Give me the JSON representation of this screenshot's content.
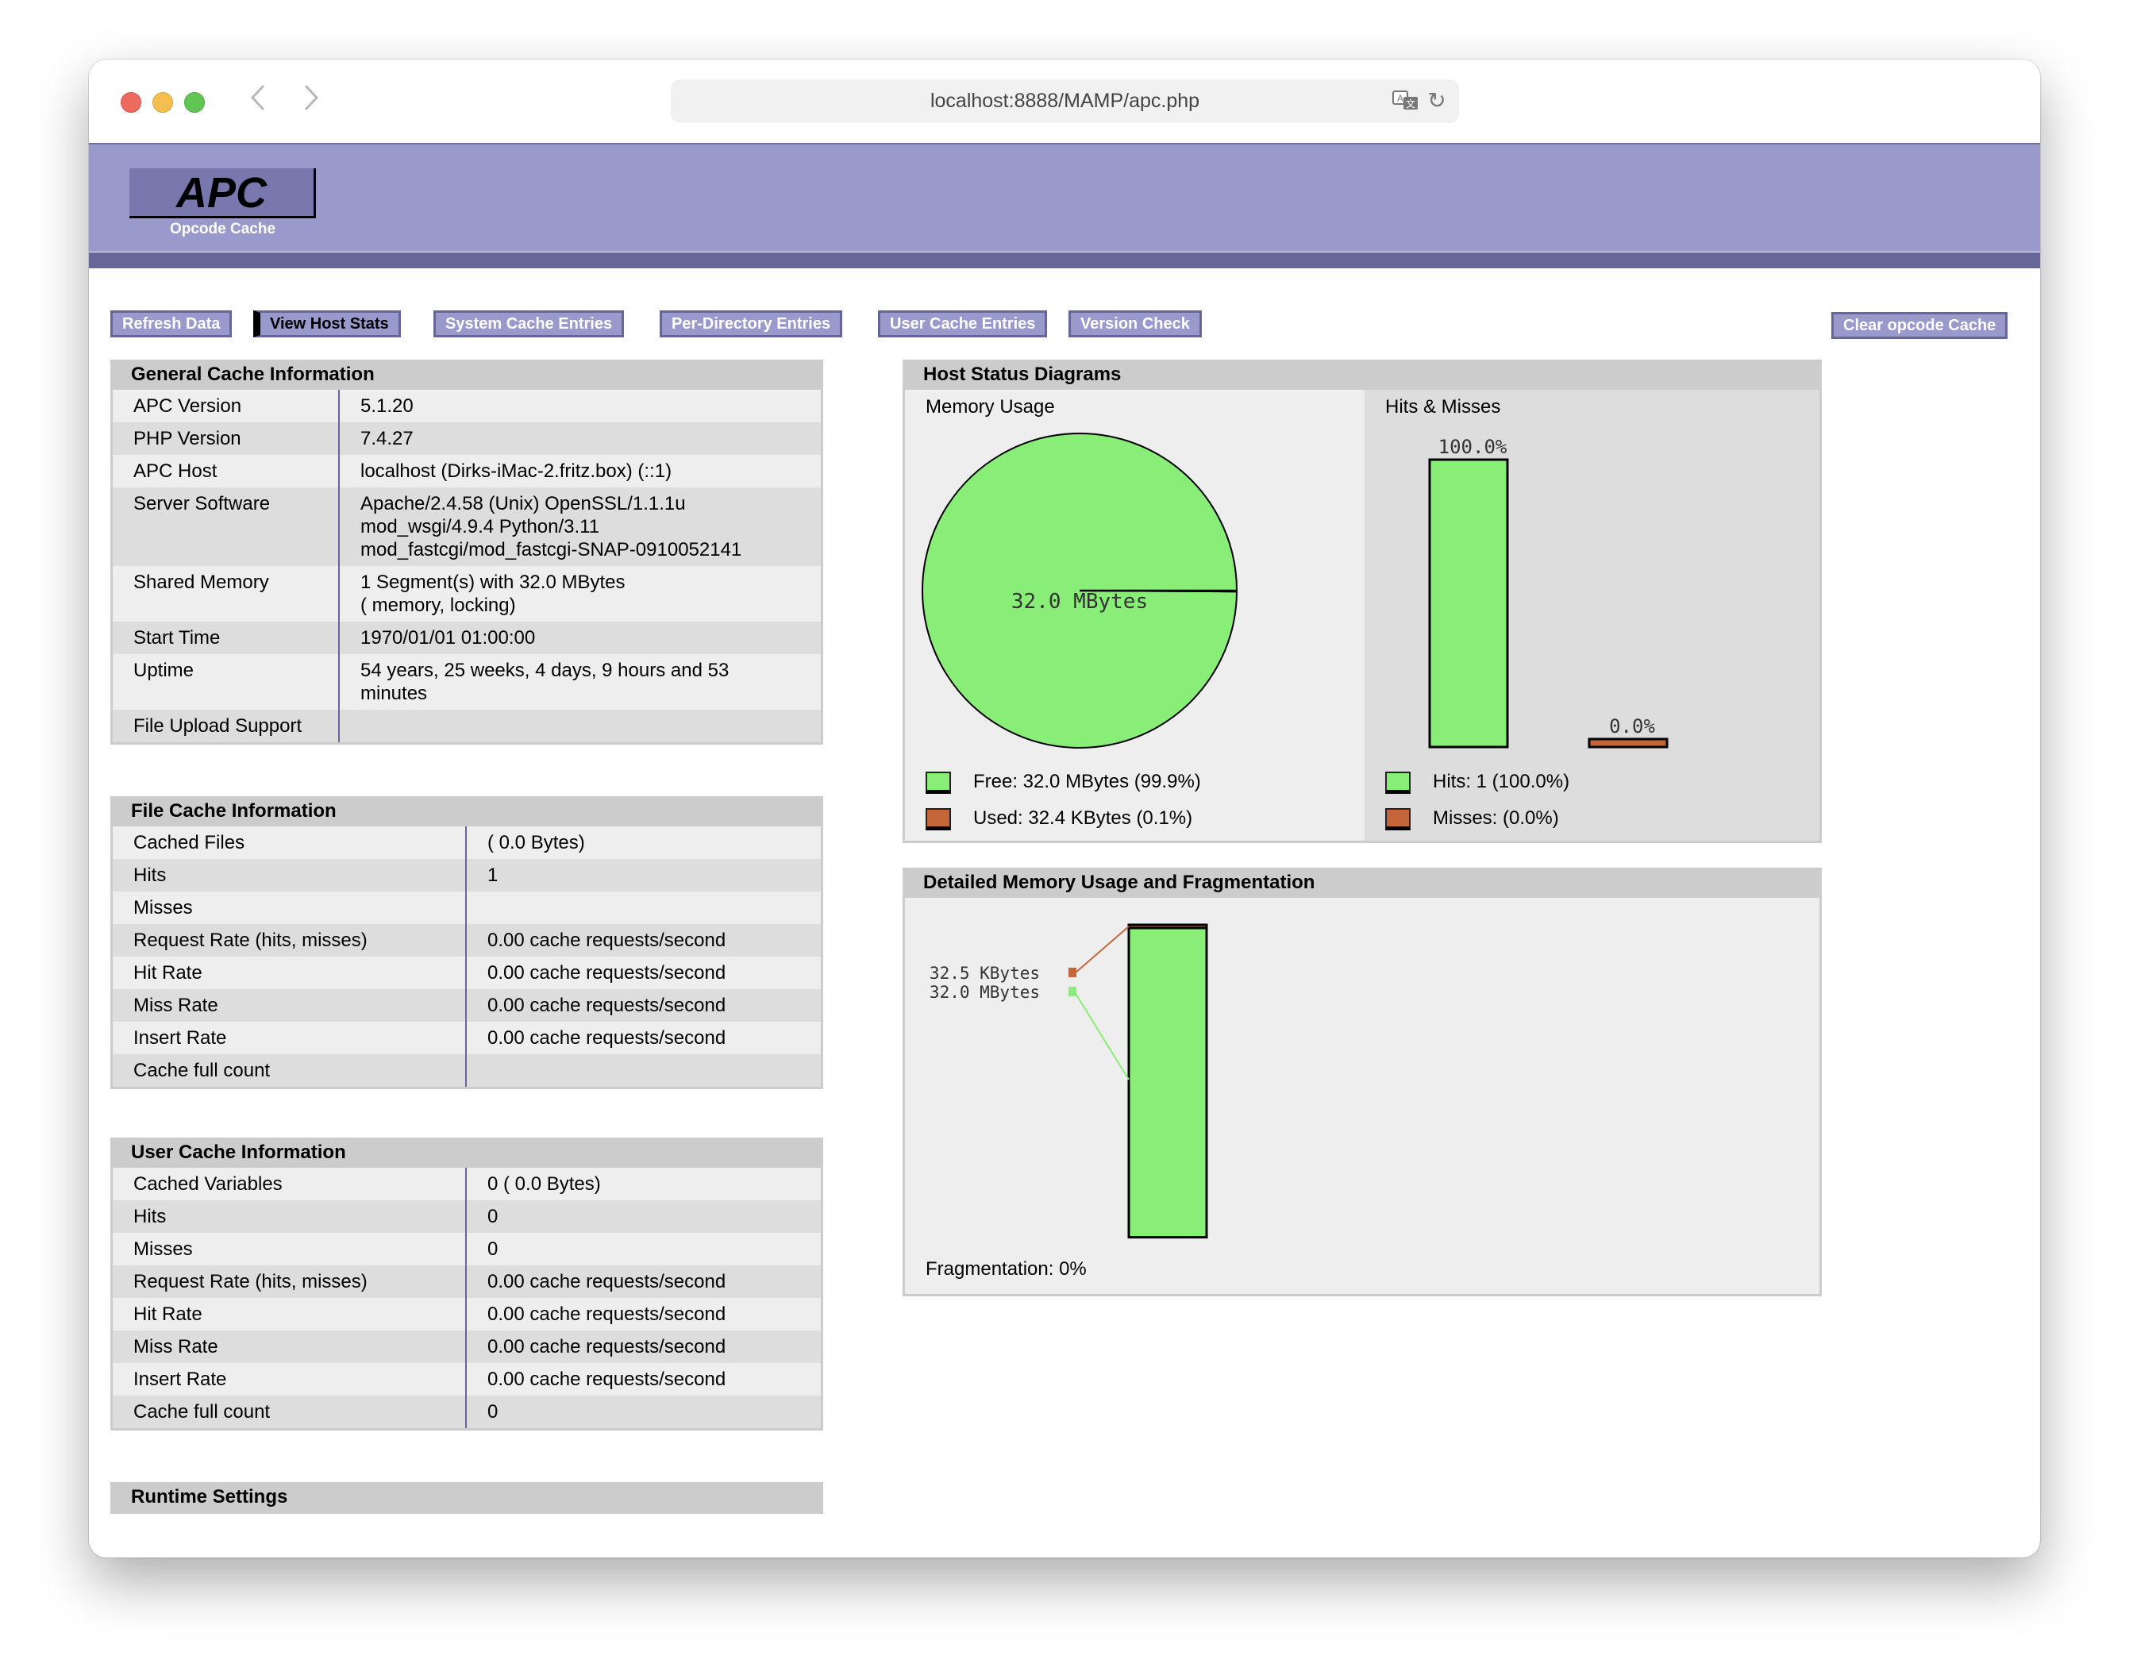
{
  "browser": {
    "url": "localhost:8888/MAMP/apc.php",
    "back_label": "‹",
    "forward_label": "›",
    "reload_glyph": "↻"
  },
  "header": {
    "logo": "APC",
    "subtitle": "Opcode Cache"
  },
  "menu": {
    "items": [
      {
        "label": "Refresh Data",
        "active": false
      },
      {
        "label": "View Host Stats",
        "active": true
      },
      {
        "label": "System Cache Entries",
        "active": false
      },
      {
        "label": "Per-Directory Entries",
        "active": false
      },
      {
        "label": "User Cache Entries",
        "active": false
      },
      {
        "label": "Version Check",
        "active": false
      }
    ],
    "clear_label": "Clear opcode Cache"
  },
  "general": {
    "title": "General Cache Information",
    "rows": [
      {
        "key": "APC Version",
        "value": "5.1.20"
      },
      {
        "key": "PHP Version",
        "value": "7.4.27"
      },
      {
        "key": "APC Host",
        "value": "localhost (Dirks-iMac-2.fritz.box) (::1)"
      },
      {
        "key": "Server Software",
        "value": "Apache/2.4.58 (Unix) OpenSSL/1.1.1u\nmod_wsgi/4.9.4 Python/3.11\nmod_fastcgi/mod_fastcgi-SNAP-0910052141"
      },
      {
        "key": "Shared Memory",
        "value": "1 Segment(s) with 32.0 MBytes\n( memory, locking)"
      },
      {
        "key": "Start Time",
        "value": "1970/01/01 01:00:00"
      },
      {
        "key": "Uptime",
        "value": "54 years, 25 weeks, 4 days, 9 hours and 53\nminutes"
      },
      {
        "key": "File Upload Support",
        "value": ""
      }
    ]
  },
  "file_cache": {
    "title": "File Cache Information",
    "rows": [
      {
        "key": "Cached Files",
        "value": "( 0.0 Bytes)"
      },
      {
        "key": "Hits",
        "value": "1"
      },
      {
        "key": "Misses",
        "value": ""
      },
      {
        "key": "Request Rate (hits, misses)",
        "value": "0.00 cache requests/second"
      },
      {
        "key": "Hit Rate",
        "value": "0.00 cache requests/second"
      },
      {
        "key": "Miss Rate",
        "value": "0.00 cache requests/second"
      },
      {
        "key": "Insert Rate",
        "value": "0.00 cache requests/second"
      },
      {
        "key": "Cache full count",
        "value": ""
      }
    ]
  },
  "user_cache": {
    "title": "User Cache Information",
    "rows": [
      {
        "key": "Cached Variables",
        "value": "0 ( 0.0 Bytes)"
      },
      {
        "key": "Hits",
        "value": "0"
      },
      {
        "key": "Misses",
        "value": "0"
      },
      {
        "key": "Request Rate (hits, misses)",
        "value": "0.00 cache requests/second"
      },
      {
        "key": "Hit Rate",
        "value": "0.00 cache requests/second"
      },
      {
        "key": "Miss Rate",
        "value": "0.00 cache requests/second"
      },
      {
        "key": "Insert Rate",
        "value": "0.00 cache requests/second"
      },
      {
        "key": "Cache full count",
        "value": "0"
      }
    ]
  },
  "runtime": {
    "title": "Runtime Settings"
  },
  "host_status": {
    "title": "Host Status Diagrams",
    "memory_title": "Memory Usage",
    "hits_title": "Hits & Misses",
    "legend_memory": [
      {
        "label": "Free: 32.0 MBytes (99.9%)",
        "color": "#88ee77"
      },
      {
        "label": "Used: 32.4 KBytes (0.1%)",
        "color": "#c4663a"
      }
    ],
    "legend_hits": [
      {
        "label": "Hits: 1 (100.0%)",
        "color": "#88ee77"
      },
      {
        "label": "Misses: (0.0%)",
        "color": "#c4663a"
      }
    ]
  },
  "fragmentation": {
    "title": "Detailed Memory Usage and Fragmentation",
    "footer": "Fragmentation: 0%"
  },
  "colors": {
    "free": "#88ee77",
    "used": "#c4663a",
    "header": "#9999cc",
    "header_dark": "#666699"
  },
  "chart_data": [
    {
      "type": "pie",
      "title": "Memory Usage",
      "labels": [
        "Free",
        "Used"
      ],
      "values": [
        99.9,
        0.1
      ],
      "units": "percent",
      "slice_label": "32.0 MBytes",
      "colors": [
        "#88ee77",
        "#c4663a"
      ]
    },
    {
      "type": "bar",
      "title": "Hits & Misses",
      "categories": [
        "Hits",
        "Misses"
      ],
      "values": [
        100.0,
        0.0
      ],
      "data_labels": [
        "100.0%",
        "0.0%"
      ],
      "ylim": [
        0,
        100
      ],
      "colors": [
        "#88ee77",
        "#c4663a"
      ]
    },
    {
      "type": "bar",
      "title": "Detailed Memory Usage and Fragmentation",
      "stacked": true,
      "segments": [
        {
          "name": "Used",
          "value_label": "32.5 KBytes",
          "fraction": 0.001,
          "color": "#c4663a"
        },
        {
          "name": "Free",
          "value_label": "32.0 MBytes",
          "fraction": 0.999,
          "color": "#88ee77"
        }
      ]
    }
  ]
}
